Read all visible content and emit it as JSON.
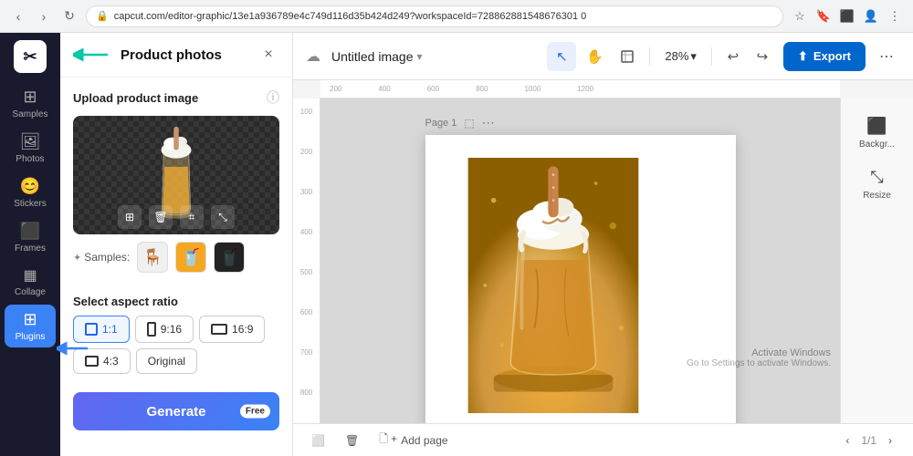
{
  "browser": {
    "url": "capcut.com/editor-graphic/13e1a936789e4c749d116d35b424d249?workspaceId=728862881548676301 0",
    "back_title": "Back",
    "forward_title": "Forward",
    "refresh_title": "Refresh"
  },
  "sidebar": {
    "logo": "✂",
    "items": [
      {
        "id": "samples",
        "label": "Samples",
        "icon": "⊞"
      },
      {
        "id": "photos",
        "label": "Photos",
        "icon": "🖼"
      },
      {
        "id": "stickers",
        "label": "Stickers",
        "icon": "😊"
      },
      {
        "id": "frames",
        "label": "Frames",
        "icon": "⬛"
      },
      {
        "id": "collage",
        "label": "Collage",
        "icon": "▦"
      },
      {
        "id": "plugins",
        "label": "Plugins",
        "icon": "⊞"
      }
    ]
  },
  "panel": {
    "title": "Product photos",
    "close_label": "×",
    "arrow_icon": "←",
    "upload_section": {
      "title": "Upload product image",
      "info_icon": "ⓘ"
    },
    "preview_controls": [
      {
        "id": "grid",
        "icon": "⊞"
      },
      {
        "id": "delete",
        "icon": "🗑"
      },
      {
        "id": "crop",
        "icon": "⌗"
      },
      {
        "id": "expand",
        "icon": "⤡"
      }
    ],
    "samples": {
      "label": "Samples:",
      "sparkle": "✦",
      "items": [
        {
          "id": "chair",
          "emoji": "🪑"
        },
        {
          "id": "drink",
          "emoji": "🥤"
        },
        {
          "id": "dark",
          "emoji": "⬛"
        }
      ]
    },
    "aspect_ratio": {
      "title": "Select aspect ratio",
      "options": [
        {
          "id": "1:1",
          "label": "1:1",
          "selected": true
        },
        {
          "id": "9:16",
          "label": "9:16",
          "selected": false
        },
        {
          "id": "16:9",
          "label": "16:9",
          "selected": false
        },
        {
          "id": "4:3",
          "label": "4:3",
          "selected": false
        },
        {
          "id": "original",
          "label": "Original",
          "selected": false
        }
      ]
    },
    "generate_btn": "Generate",
    "free_badge": "Free"
  },
  "toolbar": {
    "cloud_icon": "☁",
    "doc_title": "Untitled image",
    "doc_chevron": "▾",
    "tools": [
      {
        "id": "select",
        "icon": "↖",
        "active": true
      },
      {
        "id": "hand",
        "icon": "✋",
        "active": false
      },
      {
        "id": "frame",
        "icon": "⬜",
        "active": false
      }
    ],
    "zoom": "28%",
    "zoom_chevron": "▾",
    "undo_icon": "↩",
    "redo_icon": "↪",
    "export_icon": "⬆",
    "export_label": "Export",
    "more_icon": "⋯"
  },
  "canvas": {
    "page_label": "Page 1",
    "page_icon": "⬜",
    "page_more": "⋯",
    "ruler_labels": [
      "200",
      "400",
      "600",
      "800",
      "1000",
      "1200"
    ]
  },
  "right_panel": {
    "items": [
      {
        "id": "background",
        "icon": "⬛",
        "label": "Backgr..."
      },
      {
        "id": "resize",
        "icon": "⤡",
        "label": "Resize"
      }
    ]
  },
  "bottom_bar": {
    "fit_icon": "⬜",
    "add_page_icon": "+",
    "add_page_label": "Add page",
    "page_info": "1/1",
    "prev_icon": "‹",
    "next_icon": "›"
  },
  "activate_windows": {
    "line1": "Activate Windows",
    "line2": "Go to Settings to activate Windows."
  },
  "annotations": {
    "teal_arrow": "←",
    "blue_arrow": "←"
  }
}
